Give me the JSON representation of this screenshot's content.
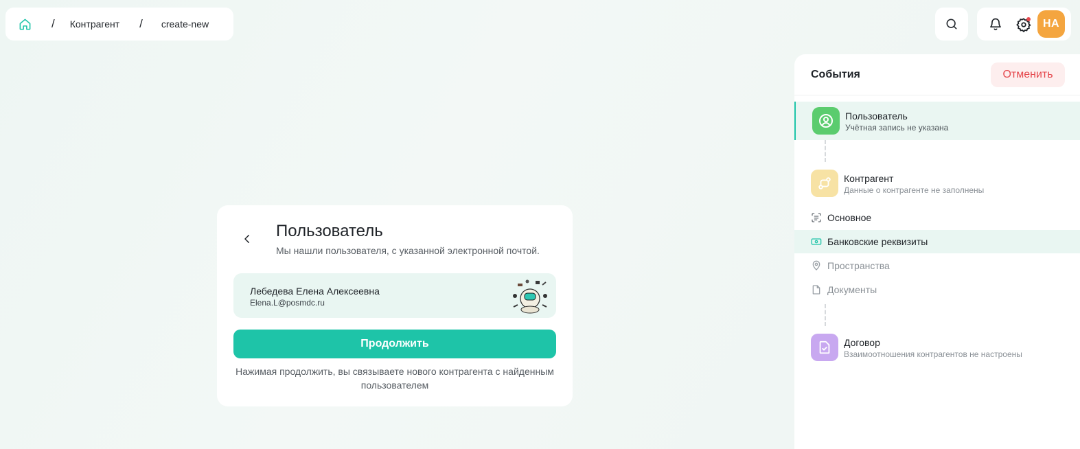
{
  "breadcrumb": {
    "home_icon": "home-icon",
    "separator": "/",
    "items": [
      "Контрагент",
      "create-new"
    ]
  },
  "topbar": {
    "search_icon": "search-icon",
    "bell_icon": "bell-icon",
    "settings_icon": "gear-icon",
    "avatar_initials": "НА",
    "avatar_color": "#f4a53f"
  },
  "card": {
    "back_icon": "chevron-left-icon",
    "title": "Пользователь",
    "subtitle": "Мы нашли пользователя, с указанной электронной почтой.",
    "user": {
      "name": "Лебедева Елена Алексеевна",
      "email": "Elena.L@posmdc.ru"
    },
    "continue_label": "Продолжить",
    "note": "Нажимая продолжить, вы связываете нового контрагента с найденным пользователем",
    "accent": "#1ec4a8"
  },
  "events": {
    "title": "События",
    "cancel_label": "Отменить",
    "steps": [
      {
        "title": "Пользователь",
        "subtitle": "Учётная запись не указана",
        "icon": "user-circle-icon",
        "color": "#5bcc6e",
        "active": true
      },
      {
        "title": "Контрагент",
        "subtitle": "Данные о контрагенте не заполнены",
        "icon": "route-icon",
        "color": "#f7e2a4"
      },
      {
        "title": "Договор",
        "subtitle": "Взаимоотношения контрагентов не настроены",
        "icon": "document-check-icon",
        "color": "#c8a8f0"
      }
    ],
    "sub_items": [
      {
        "label": "Основное",
        "icon": "scan-text-icon"
      },
      {
        "label": "Банковские реквизиты",
        "icon": "banknote-icon",
        "highlighted": true
      },
      {
        "label": "Пространства",
        "icon": "map-pin-icon"
      },
      {
        "label": "Документы",
        "icon": "file-icon"
      }
    ]
  }
}
